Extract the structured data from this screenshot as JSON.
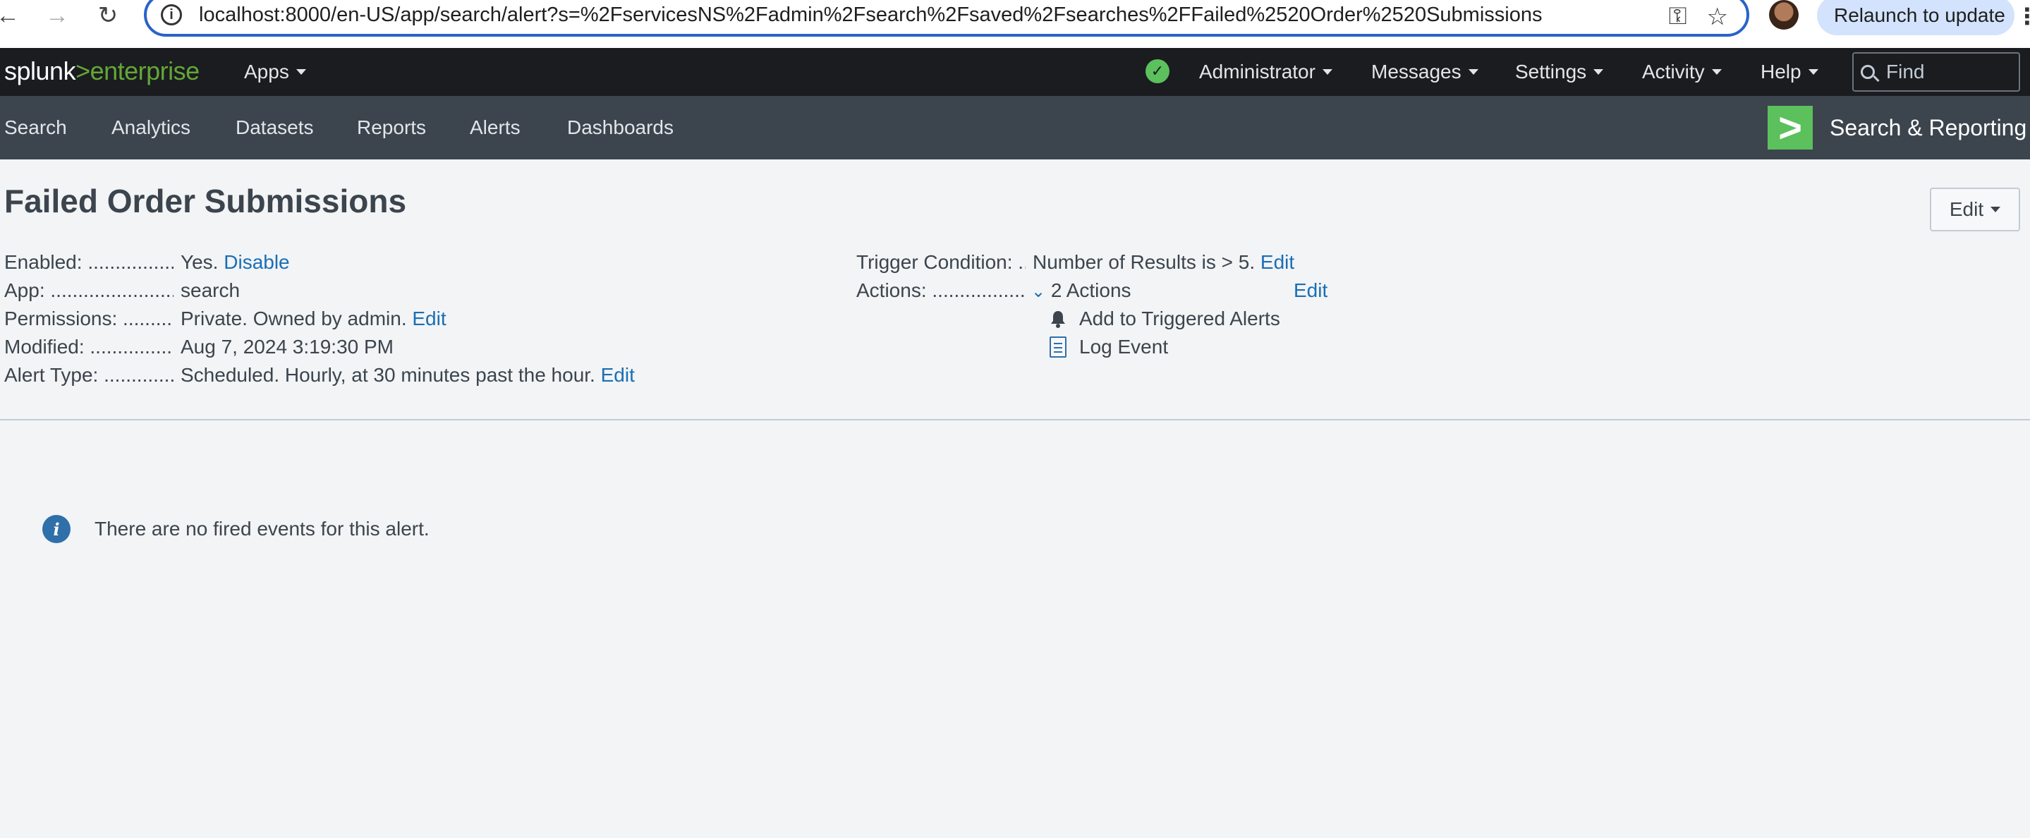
{
  "browser": {
    "url": "localhost:8000/en-US/app/search/alert?s=%2FservicesNS%2Fadmin%2Fsearch%2Fsaved%2Fsearches%2FFailed%2520Order%2520Submissions",
    "relaunch_label": "Relaunch to update"
  },
  "topbar": {
    "logo_splunk": "splunk",
    "logo_gt": ">",
    "logo_enterprise": "enterprise",
    "apps_label": "Apps",
    "user_label": "Administrator",
    "messages_label": "Messages",
    "settings_label": "Settings",
    "activity_label": "Activity",
    "help_label": "Help",
    "find_placeholder": "Find"
  },
  "appbar": {
    "nav": [
      "Search",
      "Analytics",
      "Datasets",
      "Reports",
      "Alerts",
      "Dashboards"
    ],
    "app_logo": ">",
    "app_title": "Search & Reporting"
  },
  "alert": {
    "title": "Failed Order Submissions",
    "edit_button": "Edit",
    "left": {
      "enabled_label": "Enabled: ......................",
      "enabled_value": "Yes.",
      "enabled_action": "Disable",
      "app_label": "App: ..............................",
      "app_value": "search",
      "permissions_label": "Permissions: ............",
      "permissions_value": "Private. Owned by admin.",
      "permissions_action": "Edit",
      "modified_label": "Modified: ...................",
      "modified_value": "Aug 7, 2024 3:19:30 PM",
      "alert_type_label": "Alert Type: ................",
      "alert_type_value": "Scheduled. Hourly, at 30 minutes past the hour.",
      "alert_type_action": "Edit"
    },
    "right": {
      "trigger_label": "Trigger Condition: ..",
      "trigger_value": "Number of Results is > 5.",
      "trigger_action": "Edit",
      "actions_label": "Actions: ......................",
      "actions_value": "2 Actions",
      "actions_action": "Edit",
      "action_items": [
        "Add to Triggered Alerts",
        "Log Event"
      ]
    },
    "empty_message": "There are no fired events for this alert."
  },
  "colors": {
    "brand_green": "#65a637",
    "link_blue": "#1a6eb5",
    "topbar_bg": "#1a1c20",
    "appbar_bg": "#3c444d"
  }
}
